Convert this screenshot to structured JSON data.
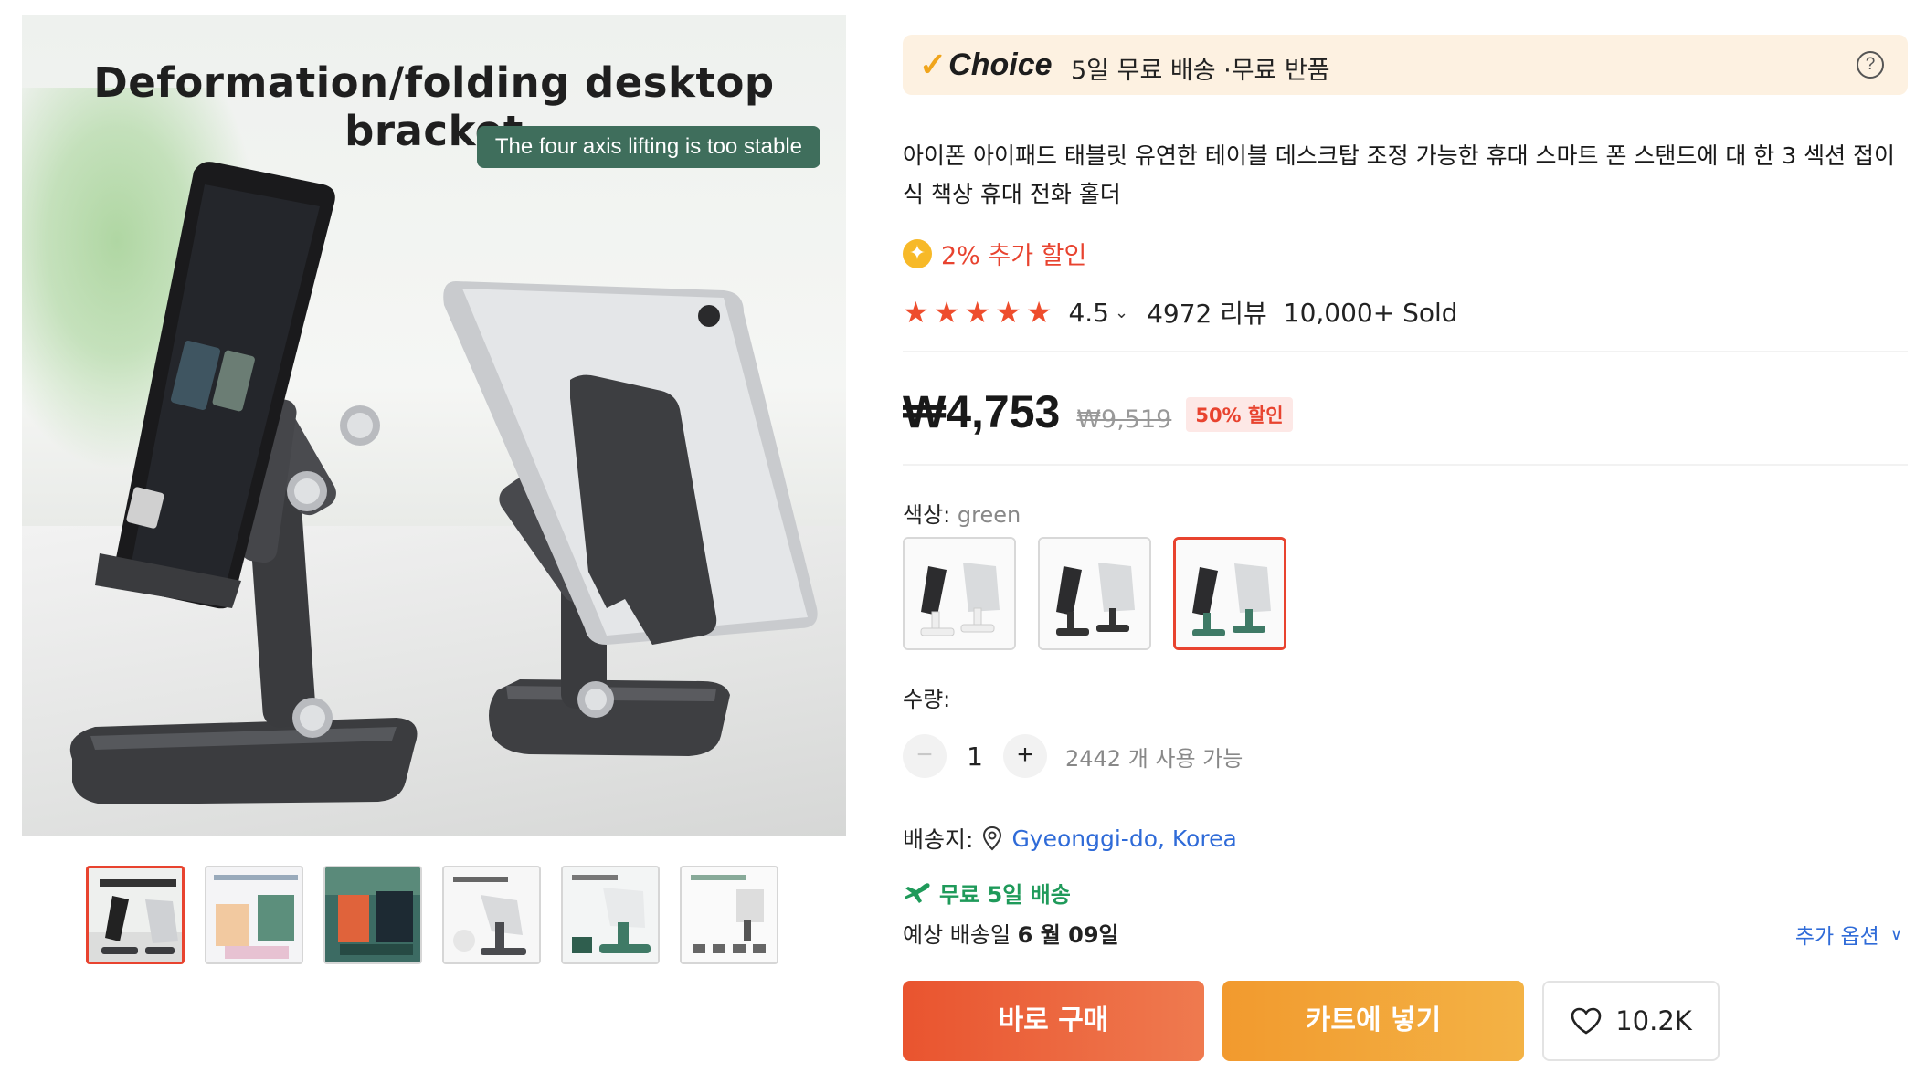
{
  "gallery": {
    "main_image": {
      "headline": "Deformation/folding desktop bracket",
      "pill_text": "The four axis lifting is too stable"
    },
    "thumbnails_count": 6,
    "active_thumbnail_index": 0
  },
  "choice_bar": {
    "logo_text": "Choice",
    "shipping_text": "5일 무료 배송 ·무료 반품",
    "help_icon": "?"
  },
  "product": {
    "title": "아이폰 아이패드 태블릿 유연한 테이블 데스크탑 조정 가능한 휴대 스마트 폰 스탠드에 대 한 3 섹션 접이식 책상 휴대 전화 홀더",
    "extra_discount": "2% 추가 할인",
    "rating": "4.5",
    "stars": 5,
    "reviews": "4972 리뷰",
    "sold": "10,000+ Sold"
  },
  "price": {
    "current": "₩4,753",
    "original": "₩9,519",
    "discount_badge": "50% 할인"
  },
  "color": {
    "label": "색상: ",
    "selected": "green",
    "options": [
      "white",
      "black",
      "green"
    ],
    "selected_index": 2
  },
  "quantity": {
    "label": "수량:",
    "minus": "−",
    "value": "1",
    "plus": "+",
    "available": "2442 개 사용 가능"
  },
  "shipping": {
    "label": "배송지:",
    "location": "Gyeonggi-do, Korea",
    "free_label": "무료 5일 배송",
    "eta_prefix": "예상 배송일 ",
    "eta_date": "6 월 09일",
    "more_options": "추가 옵션"
  },
  "actions": {
    "buy_now": "바로 구매",
    "add_to_cart": "카트에 넣기",
    "wishlist_count": "10.2K"
  },
  "colors": {
    "accent": "#e8432f",
    "buy_button": "#e9542f",
    "cart_button": "#f29a2e",
    "link": "#2f6bd8",
    "free_shipping": "#1f9a5a",
    "choice_bar_bg": "#fdf1e1",
    "star": "#ee4d2d"
  }
}
